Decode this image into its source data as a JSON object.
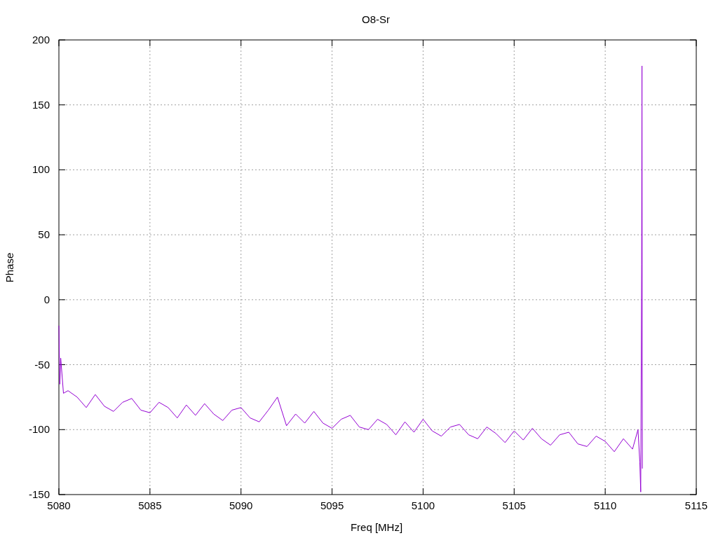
{
  "chart_data": {
    "type": "line",
    "grid": true,
    "title": "O8-Sr",
    "xlabel": "Freq [MHz]",
    "ylabel": "Phase",
    "xlim": [
      5080,
      5115
    ],
    "ylim": [
      -150,
      200
    ],
    "xticks": [
      5080,
      5085,
      5090,
      5095,
      5100,
      5105,
      5110,
      5115
    ],
    "yticks": [
      -150,
      -100,
      -50,
      0,
      50,
      100,
      150,
      200
    ],
    "x": [
      5080,
      5080.05,
      5080.1,
      5080.25,
      5080.5,
      5081,
      5081.5,
      5082,
      5082.5,
      5083,
      5083.5,
      5084,
      5084.5,
      5085,
      5085.5,
      5086,
      5086.5,
      5087,
      5087.5,
      5088,
      5088.5,
      5089,
      5089.5,
      5090,
      5090.5,
      5091,
      5091.5,
      5092,
      5092.5,
      5093,
      5093.5,
      5094,
      5094.5,
      5095,
      5095.5,
      5096,
      5096.5,
      5097,
      5097.5,
      5098,
      5098.5,
      5099,
      5099.5,
      5100,
      5100.5,
      5101,
      5101.5,
      5102,
      5102.5,
      5103,
      5103.5,
      5104,
      5104.5,
      5105,
      5105.5,
      5106,
      5106.5,
      5107,
      5107.5,
      5108,
      5108.5,
      5109,
      5109.5,
      5110,
      5110.5,
      5111,
      5111.5,
      5111.8,
      5111.9,
      5111.95,
      5112,
      5112.02,
      5112.04
    ],
    "series": [
      {
        "color": "#9400d3",
        "values": [
          -20,
          -65,
          -45,
          -72,
          -70,
          -75,
          -83,
          -73,
          -82,
          -86,
          -79,
          -76,
          -85,
          -87,
          -79,
          -83,
          -91,
          -81,
          -89,
          -80,
          -88,
          -93,
          -85,
          -83,
          -91,
          -94,
          -85,
          -75,
          -97,
          -88,
          -95,
          -86,
          -95,
          -99,
          -92,
          -89,
          -98,
          -100,
          -92,
          -96,
          -104,
          -94,
          -102,
          -92,
          -101,
          -105,
          -98,
          -96,
          -104,
          -107,
          -98,
          -103,
          -110,
          -101,
          -108,
          -99,
          -107,
          -112,
          -104,
          -102,
          -111,
          -113,
          -105,
          -109,
          -117,
          -107,
          -115,
          -100,
          -125,
          -148,
          27,
          180,
          -130
        ]
      }
    ]
  }
}
